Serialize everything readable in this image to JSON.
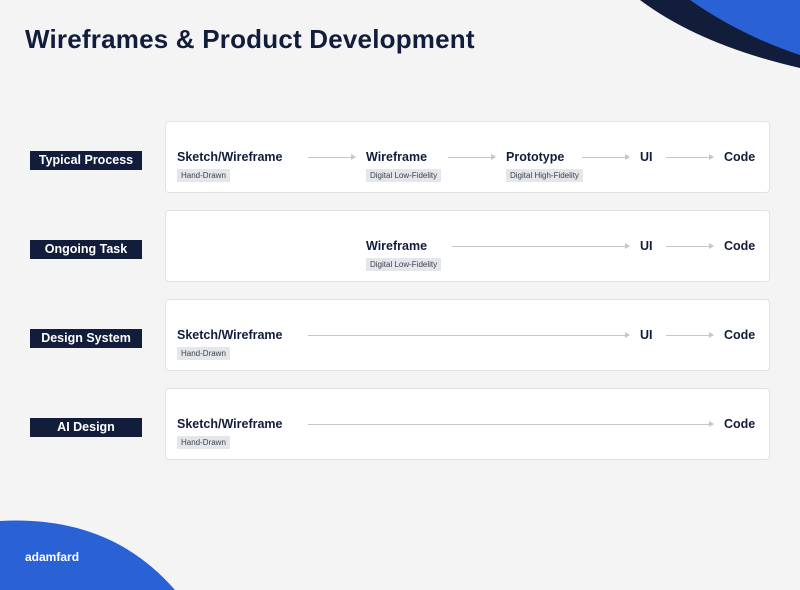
{
  "title": "Wireframes & Product Development",
  "brand": "adamfard",
  "colors": {
    "navy": "#121d3c",
    "blue": "#2a62d6",
    "background": "#f4f4f4"
  },
  "rows": [
    {
      "label": "Typical Process",
      "nodes": [
        {
          "title": "Sketch/Wireframe",
          "tag": "Hand-Drawn"
        },
        {
          "title": "Wireframe",
          "tag": "Digital Low-Fidelity"
        },
        {
          "title": "Prototype",
          "tag": "Digital High-Fidelity"
        },
        {
          "title": "UI"
        },
        {
          "title": "Code"
        }
      ]
    },
    {
      "label": "Ongoing Task",
      "nodes": [
        {
          "title": "Wireframe",
          "tag": "Digital Low-Fidelity"
        },
        {
          "title": "UI"
        },
        {
          "title": "Code"
        }
      ]
    },
    {
      "label": "Design System",
      "nodes": [
        {
          "title": "Sketch/Wireframe",
          "tag": "Hand-Drawn"
        },
        {
          "title": "UI"
        },
        {
          "title": "Code"
        }
      ]
    },
    {
      "label": "AI Design",
      "nodes": [
        {
          "title": "Sketch/Wireframe",
          "tag": "Hand-Drawn"
        },
        {
          "title": "Code"
        }
      ]
    }
  ]
}
